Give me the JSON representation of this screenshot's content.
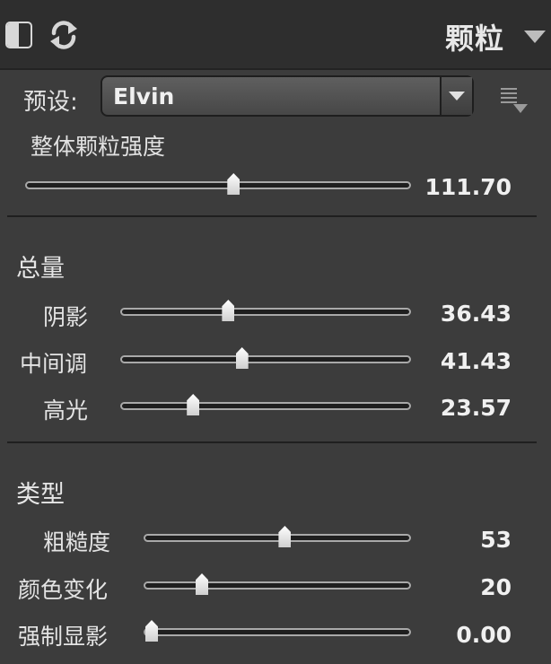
{
  "header": {
    "title": "颗粒",
    "compare_icon": "split-compare-icon",
    "reset_icon": "reset-icon",
    "collapse_icon": "triangle-down-icon"
  },
  "preset": {
    "label": "预设:",
    "value": "Elvin",
    "menu_icon": "list-menu-icon"
  },
  "master": {
    "label": "整体颗粒强度",
    "value_text": "111.70",
    "value": 111.7,
    "fraction": 0.542
  },
  "amount": {
    "title": "总量",
    "sliders": [
      {
        "label": "阴影",
        "value_text": "36.43",
        "value": 36.43,
        "fraction": 0.364
      },
      {
        "label": "中间调",
        "value_text": "41.43",
        "value": 41.43,
        "fraction": 0.414
      },
      {
        "label": "高光",
        "value_text": "23.57",
        "value": 23.57,
        "fraction": 0.236
      }
    ]
  },
  "type": {
    "title": "类型",
    "sliders": [
      {
        "label": "粗糙度",
        "value_text": "53",
        "value": 53,
        "fraction": 0.53
      },
      {
        "label": "颜色变化",
        "value_text": "20",
        "value": 20,
        "fraction": 0.2
      },
      {
        "label": "强制显影",
        "value_text": "0.00",
        "value": 0.0,
        "fraction": 0.0
      }
    ]
  },
  "colors": {
    "panel_bg": "#3c3c3c",
    "header_bg": "#2e2e2e",
    "track_bg": "#1f1f1f",
    "track_border": "#a9a9a9",
    "thumb": "#f2f2f2",
    "text": "#e2e2e2"
  }
}
